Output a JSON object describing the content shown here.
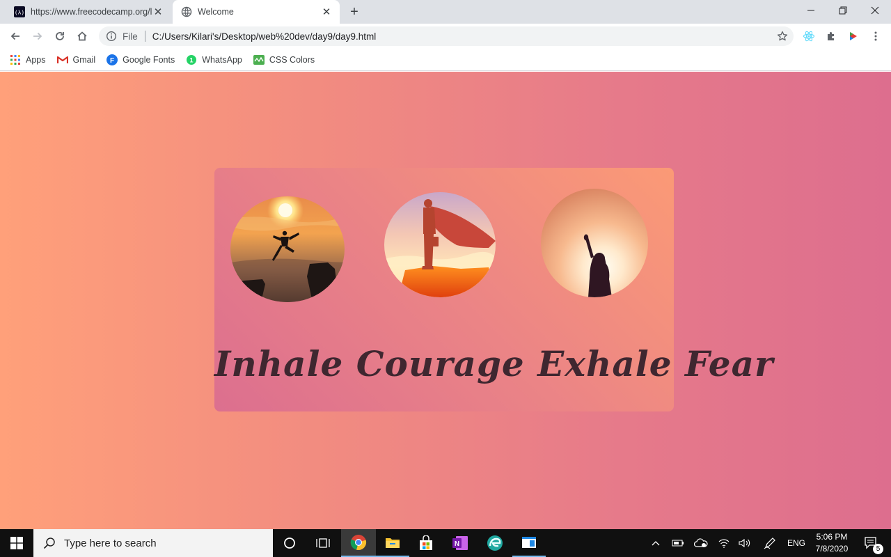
{
  "browser": {
    "tabs": [
      {
        "title": "https://www.freecodecamp.org/learn",
        "icon": "freecodecamp-icon",
        "active": false
      },
      {
        "title": "Welcome",
        "icon": "globe-icon",
        "active": true
      }
    ],
    "address": {
      "scheme_label": "File",
      "url": "C:/Users/Kilari's/Desktop/web%20dev/day9/day9.html"
    },
    "bookmarks": [
      {
        "label": "Apps",
        "icon": "apps-grid-icon"
      },
      {
        "label": "Gmail",
        "icon": "gmail-icon"
      },
      {
        "label": "Google Fonts",
        "icon": "google-fonts-icon"
      },
      {
        "label": "WhatsApp",
        "icon": "whatsapp-icon"
      },
      {
        "label": "CSS Colors",
        "icon": "css-colors-icon"
      }
    ]
  },
  "page": {
    "quote": "Inhale Courage Exhale Fear",
    "images": [
      {
        "name": "runner-jumping-cliff-photo"
      },
      {
        "name": "caped-hero-photo"
      },
      {
        "name": "raised-fist-woman-photo"
      }
    ],
    "colors": {
      "gradient_start": "#ffa07a",
      "gradient_end": "#dd6e8e",
      "quote_text": "#3f2730"
    }
  },
  "taskbar": {
    "search_placeholder": "Type here to search",
    "language": "ENG",
    "time": "5:06 PM",
    "date": "7/8/2020",
    "notification_count": "5"
  }
}
